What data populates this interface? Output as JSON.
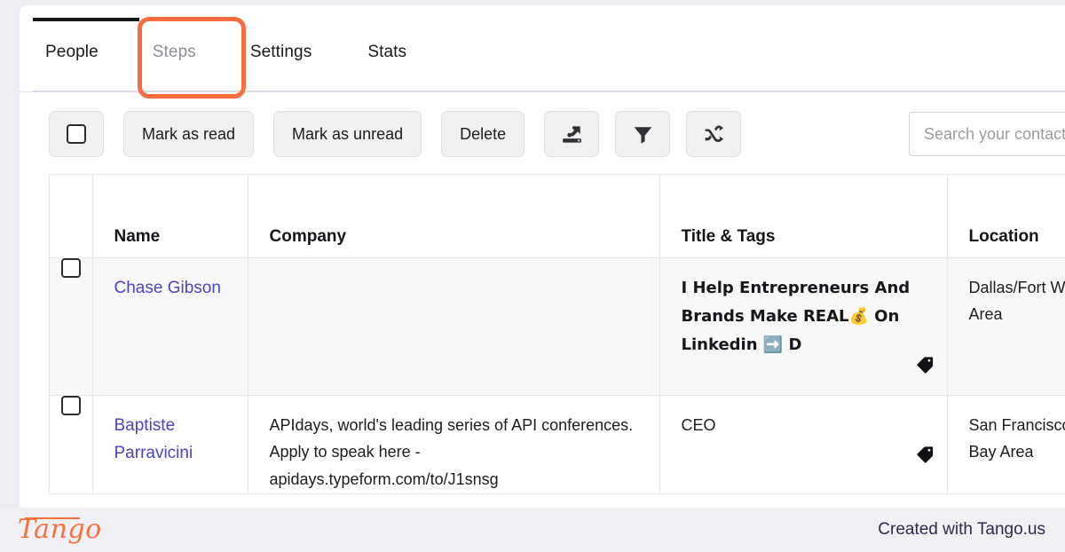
{
  "tabs": [
    {
      "label": "People",
      "state": "active"
    },
    {
      "label": "Steps",
      "state": "highlighted"
    },
    {
      "label": "Settings",
      "state": "normal"
    },
    {
      "label": "Stats",
      "state": "normal"
    }
  ],
  "toolbar": {
    "select_all_label": "",
    "mark_read_label": "Mark as read",
    "mark_unread_label": "Mark as unread",
    "delete_label": "Delete",
    "export_icon": "export-icon",
    "filter_icon": "filter-icon",
    "shuffle_icon": "shuffle-icon"
  },
  "search": {
    "placeholder": "Search your contacts",
    "value": ""
  },
  "table": {
    "headers": [
      "",
      "Name",
      "Company",
      "Title & Tags",
      "Location"
    ],
    "rows": [
      {
        "name": "Chase Gibson",
        "company": "",
        "title": "I Help Entrepreneurs And Brands Make REAL💰 On Linkedin ➡️ D",
        "title_style": "bold-italic",
        "has_tag": true,
        "location": "Dallas/Fort Worth Area"
      },
      {
        "name": "Baptiste Parravicini",
        "company": "APIdays, world's leading series of API conferences. Apply to speak here - apidays.typeform.com/to/J1snsg",
        "title": "CEO",
        "title_style": "plain",
        "has_tag": true,
        "location": "San Francisco Bay Area"
      }
    ]
  },
  "footer": {
    "logo_text": "Tango",
    "note": "Created with Tango.us"
  },
  "colors": {
    "highlight_ring": "#f96c3d",
    "link": "#4b44c0",
    "brand_orange": "#f9703e",
    "page_bg": "#eceef3",
    "footer_bg": "#f1f0f5"
  }
}
